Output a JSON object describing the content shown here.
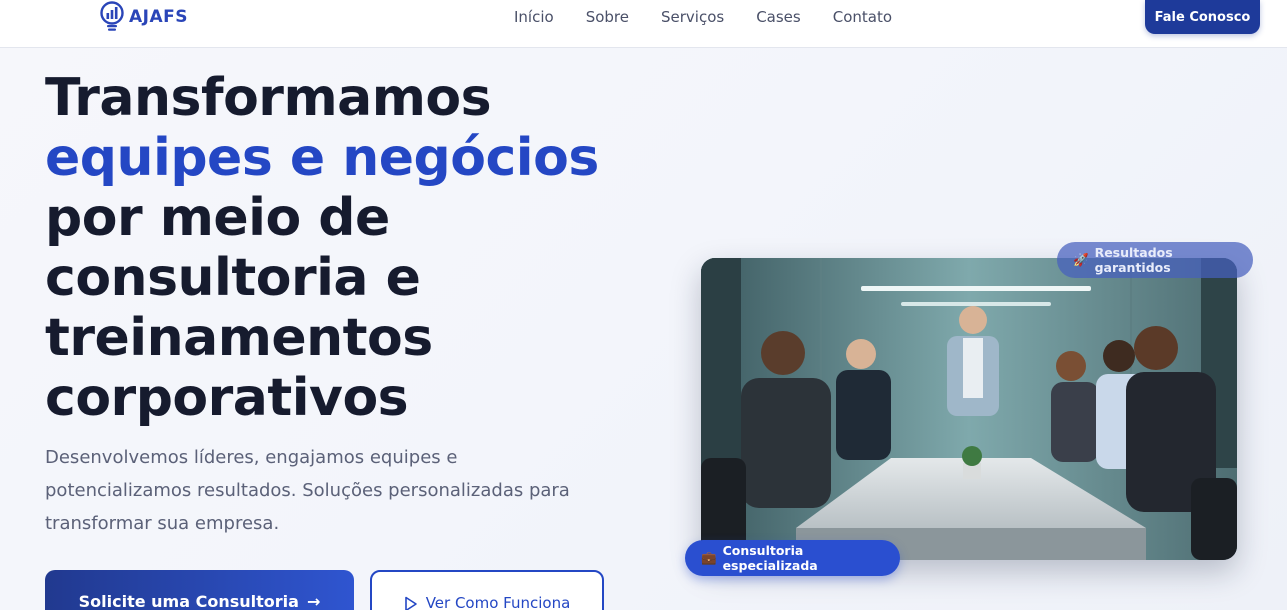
{
  "brand": {
    "name": "AJAFS"
  },
  "nav": {
    "items": [
      "Início",
      "Sobre",
      "Serviços",
      "Cases",
      "Contato"
    ],
    "cta_label": "Fale Conosco"
  },
  "hero": {
    "title_line1": "Transformamos",
    "title_line2": "equipes e negócios",
    "title_line3": "por meio de",
    "title_line4": "consultoria e",
    "title_line5": "treinamentos",
    "title_line6": "corporativos",
    "description": "Desenvolvemos líderes, engajamos equipes e potencializamos resultados. Soluções personalizadas para transformar sua empresa.",
    "primary_button": "Solicite uma Consultoria",
    "secondary_button": "Ver Como Funciona"
  },
  "image_card": {
    "badge_top": "Resultados garantidos",
    "badge_bottom": "Consultoria especializada"
  },
  "colors": {
    "brand_blue": "#2447c4",
    "dark_navy": "#1e3a9a",
    "title_dark": "#161b2e"
  }
}
